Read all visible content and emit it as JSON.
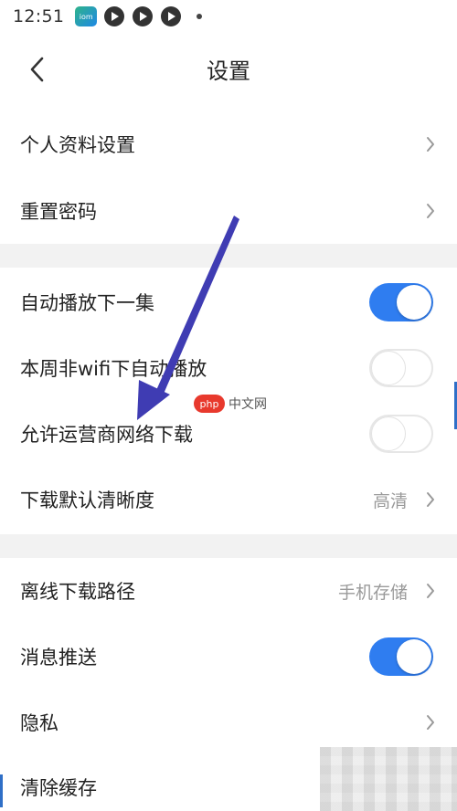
{
  "status_bar": {
    "time": "12:51",
    "app_badge": "iom",
    "icons": [
      "app-badge-icon",
      "play-notification-icon",
      "play-notification-icon",
      "play-notification-icon",
      "dot-icon"
    ]
  },
  "header": {
    "title": "设置",
    "back_icon": "chevron-left-icon"
  },
  "groups": [
    {
      "items": [
        {
          "label": "个人资料设置",
          "control": "chevron"
        },
        {
          "label": "重置密码",
          "control": "chevron"
        }
      ]
    },
    {
      "items": [
        {
          "label": "自动播放下一集",
          "control": "toggle",
          "on": true
        },
        {
          "label": "本周非wifi下自动播放",
          "control": "toggle",
          "on": false
        },
        {
          "label": "允许运营商网络下载",
          "control": "toggle",
          "on": false
        },
        {
          "label": "下载默认清晰度",
          "value": "高清",
          "control": "chevron"
        }
      ]
    },
    {
      "items": [
        {
          "label": "离线下载路径",
          "value": "手机存储",
          "control": "chevron"
        },
        {
          "label": "消息推送",
          "control": "toggle",
          "on": true
        },
        {
          "label": "隐私",
          "control": "chevron"
        },
        {
          "label": "清除缓存",
          "control": "none"
        }
      ]
    }
  ],
  "watermark": {
    "badge": "php",
    "text": "中文网"
  },
  "colors": {
    "accent": "#2f7df0",
    "arrow": "#3f3cb3",
    "divider": "#f2f2f2",
    "secondary_text": "#9a9a9a"
  }
}
